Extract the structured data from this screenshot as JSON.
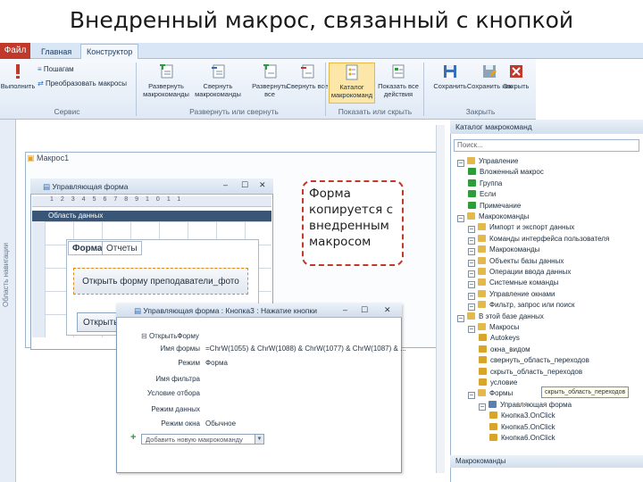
{
  "slide_title": "Внедренный макрос, связанный с кнопкой",
  "ribbon": {
    "file_tab": "Файл",
    "tabs": [
      "Главная",
      "Конструктор"
    ],
    "small_items": [
      "Выполнить",
      "Преобразовать макросы"
    ],
    "buttons": [
      {
        "label": "Развернуть макрокоманды",
        "icon": "expand-green-icon"
      },
      {
        "label": "Свернуть макрокоманды",
        "icon": "collapse-icon"
      },
      {
        "label": "Развернуть все",
        "icon": "expand-all-icon"
      },
      {
        "label": "Свернуть все",
        "icon": "collapse-all-icon"
      },
      {
        "label": "Каталог макрокоманд",
        "icon": "catalog-icon"
      },
      {
        "label": "Показать все действия",
        "icon": "show-all-icon"
      },
      {
        "label": "Сохранить",
        "icon": "save-icon"
      },
      {
        "label": "Сохранить как",
        "icon": "save-as-icon"
      },
      {
        "label": "Закрыть",
        "icon": "close-red-icon"
      }
    ],
    "groups": [
      "Сервис",
      "Развернуть или свернуть",
      "Показать или скрыть",
      "Закрыть"
    ]
  },
  "nav_pane_label": "Область навигации",
  "macro_tab_label": "Макрос1",
  "form_window": {
    "title": "Управляющая форма",
    "area_label": "Область данных",
    "tabs": [
      "Форма",
      "Отчеты"
    ],
    "button_label": "Открыть форму преподаватели_фото",
    "button2_label": "Открыть"
  },
  "callout_text": "Форма копируется с внедренным макросом",
  "macro_window": {
    "title": "Управляющая форма : Кнопка3 : Нажатие кнопки",
    "action": "ОткрытьФорму",
    "props": [
      {
        "label": "Имя формы",
        "value": "=ChrW(1055) & ChrW(1088) & ChrW(1077) & ChrW(1087) & ..."
      },
      {
        "label": "Режим",
        "value": "Форма"
      },
      {
        "label": "Имя фильтра",
        "value": ""
      },
      {
        "label": "Условие отбора",
        "value": ""
      },
      {
        "label": "Режим данных",
        "value": ""
      },
      {
        "label": "Режим окна",
        "value": "Обычное"
      }
    ],
    "add_placeholder": "Добавить новую макрокоманду"
  },
  "catalog": {
    "header": "Каталог макрокоманд",
    "search_placeholder": "Поиск...",
    "items": [
      {
        "text": "Управление",
        "level": 0,
        "kind": "folder"
      },
      {
        "text": "Вложенный макрос",
        "level": 1,
        "kind": "green"
      },
      {
        "text": "Группа",
        "level": 1,
        "kind": "green"
      },
      {
        "text": "Если",
        "level": 1,
        "kind": "green"
      },
      {
        "text": "Примечание",
        "level": 1,
        "kind": "green"
      },
      {
        "text": "Макрокоманды",
        "level": 0,
        "kind": "folder"
      },
      {
        "text": "Импорт и экспорт данных",
        "level": 1,
        "kind": "folder"
      },
      {
        "text": "Команды интерфейса пользователя",
        "level": 1,
        "kind": "folder"
      },
      {
        "text": "Макрокоманды",
        "level": 1,
        "kind": "folder"
      },
      {
        "text": "Объекты базы данных",
        "level": 1,
        "kind": "folder"
      },
      {
        "text": "Операции ввода данных",
        "level": 1,
        "kind": "folder"
      },
      {
        "text": "Системные команды",
        "level": 1,
        "kind": "folder"
      },
      {
        "text": "Управление окнами",
        "level": 1,
        "kind": "folder"
      },
      {
        "text": "Фильтр, запрос или поиск",
        "level": 1,
        "kind": "folder"
      },
      {
        "text": "В этой базе данных",
        "level": 0,
        "kind": "folder"
      },
      {
        "text": "Макросы",
        "level": 1,
        "kind": "folder"
      },
      {
        "text": "Autokeys",
        "level": 2,
        "kind": "macro"
      },
      {
        "text": "окна_видом",
        "level": 2,
        "kind": "macro"
      },
      {
        "text": "свернуть_область_переходов",
        "level": 2,
        "kind": "macro"
      },
      {
        "text": "скрыть_область_переходов",
        "level": 2,
        "kind": "macro"
      },
      {
        "text": "условие",
        "level": 2,
        "kind": "macro"
      },
      {
        "text": "Формы",
        "level": 1,
        "kind": "folder"
      },
      {
        "text": "Управляющая форма",
        "level": 2,
        "kind": "form"
      },
      {
        "text": "Кнопка3.OnClick",
        "level": 3,
        "kind": "macro"
      },
      {
        "text": "Кнопка5.OnClick",
        "level": 3,
        "kind": "macro"
      },
      {
        "text": "Кнопка6.OnClick",
        "level": 3,
        "kind": "macro"
      }
    ],
    "tooltip": "скрыть_область_переходов",
    "footer": "Макрокоманды"
  },
  "colors": {
    "accent": "#c0392b",
    "ribbon_hl": "#fde7a8",
    "green_icon": "#2e9c3a"
  }
}
